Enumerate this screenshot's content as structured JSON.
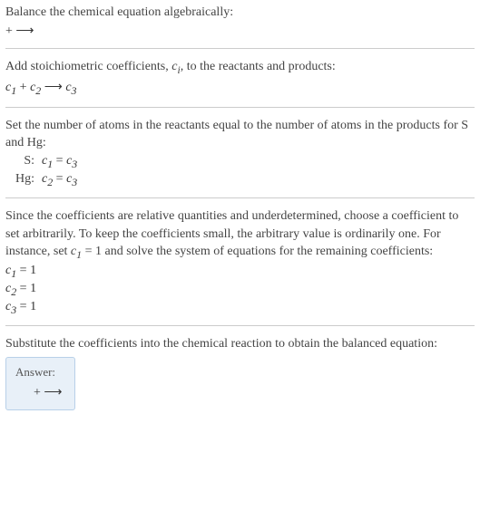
{
  "section1": {
    "title": "Balance the chemical equation algebraically:",
    "eq": " +  ⟶"
  },
  "section2": {
    "title": "Add stoichiometric coefficients, c_i, to the reactants and products:",
    "eq_c1": "c",
    "eq_s1": "1",
    "eq_plus": " + ",
    "eq_c2": "c",
    "eq_s2": "2",
    "eq_arrow": "  ⟶ ",
    "eq_c3": "c",
    "eq_s3": "3"
  },
  "section3": {
    "title": "Set the number of atoms in the reactants equal to the number of atoms in the products for S and Hg:",
    "rows": [
      {
        "label": "S:",
        "c1": "c",
        "s1": "1",
        "eq": " = ",
        "c2": "c",
        "s2": "3"
      },
      {
        "label": "Hg:",
        "c1": "c",
        "s1": "2",
        "eq": " = ",
        "c2": "c",
        "s2": "3"
      }
    ]
  },
  "section4": {
    "title_p1": "Since the coefficients are relative quantities and underdetermined, choose a coefficient to set arbitrarily. To keep the coefficients small, the arbitrary value is ordinarily one. For instance, set ",
    "title_c": "c",
    "title_s": "1",
    "title_p2": " = 1 and solve the system of equations for the remaining coefficients:",
    "lines": [
      {
        "c": "c",
        "s": "1",
        "rest": " = 1"
      },
      {
        "c": "c",
        "s": "2",
        "rest": " = 1"
      },
      {
        "c": "c",
        "s": "3",
        "rest": " = 1"
      }
    ]
  },
  "section5": {
    "title": "Substitute the coefficients into the chemical reaction to obtain the balanced equation:",
    "answer_label": "Answer:",
    "answer_eq": " +  ⟶"
  }
}
